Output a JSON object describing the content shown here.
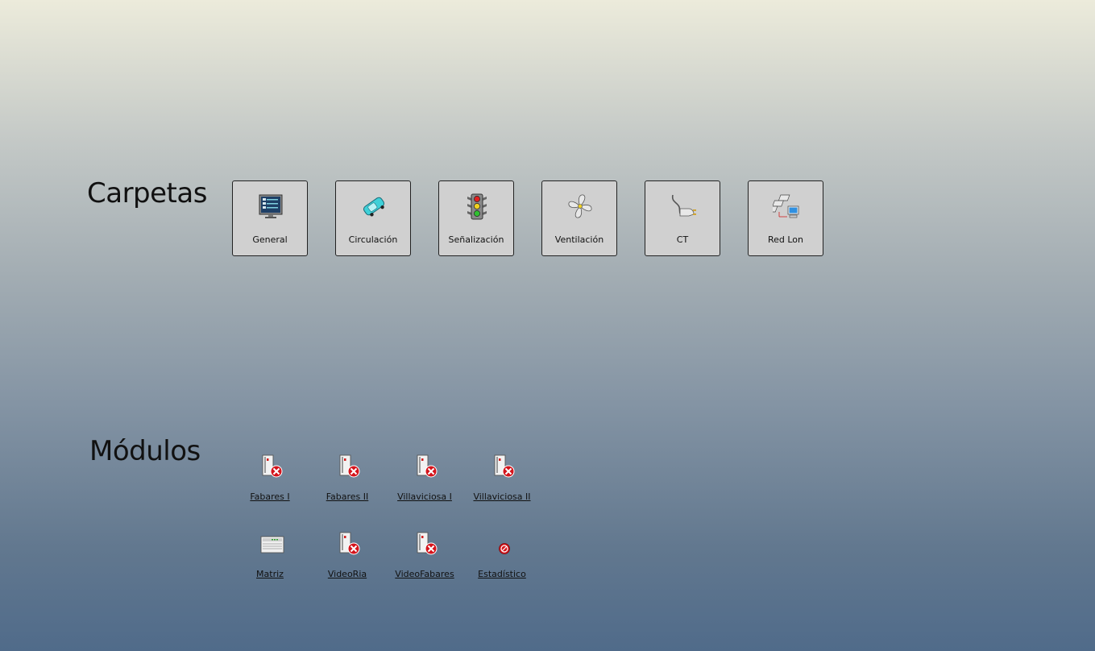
{
  "sections": {
    "carpetas": "Carpetas",
    "modulos": "Módulos"
  },
  "folders": [
    {
      "label": "General",
      "icon": "control-panel-icon"
    },
    {
      "label": "Circulación",
      "icon": "car-icon"
    },
    {
      "label": "Señalización",
      "icon": "traffic-light-icon"
    },
    {
      "label": "Ventilación",
      "icon": "fan-icon"
    },
    {
      "label": "CT",
      "icon": "power-plug-icon"
    },
    {
      "label": "Red Lon",
      "icon": "network-icon"
    }
  ],
  "modules": [
    {
      "label": "Fabares I",
      "icon": "module-error-icon",
      "status": "error"
    },
    {
      "label": "Fabares II",
      "icon": "module-error-icon",
      "status": "error"
    },
    {
      "label": "Villaviciosa I",
      "icon": "module-error-icon",
      "status": "error"
    },
    {
      "label": "Villaviciosa II",
      "icon": "module-error-icon",
      "status": "error"
    },
    {
      "label": "Matriz",
      "icon": "matrix-device-icon",
      "status": "ok"
    },
    {
      "label": "VideoRia",
      "icon": "module-error-icon",
      "status": "error"
    },
    {
      "label": "VideoFabares",
      "icon": "module-error-icon",
      "status": "error"
    },
    {
      "label": "Estadístico",
      "icon": "disabled-icon",
      "status": "disabled"
    }
  ],
  "colors": {
    "error": "#d4141c",
    "button_bg": "#d0d0d0"
  }
}
